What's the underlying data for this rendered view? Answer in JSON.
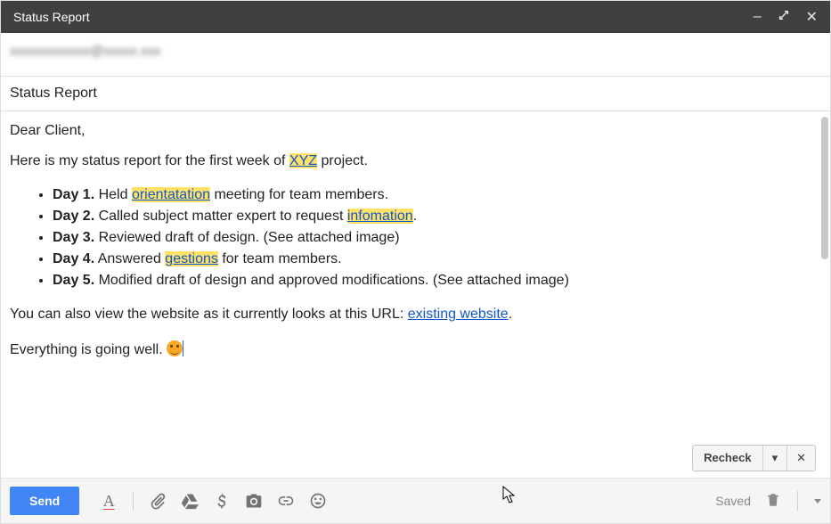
{
  "window": {
    "title": "Status Report",
    "controls": {
      "minimize": "–",
      "restore": "⤡",
      "close": "✕"
    }
  },
  "to_field": "xxxxxxxxxxxx@xxxxx.xxx",
  "subject": "Status Report",
  "body": {
    "greeting": "Dear Client,",
    "intro_pre": "Here is my status report for the first week of ",
    "intro_hl": "XYZ",
    "intro_post": " project.",
    "items": [
      {
        "day": "Day 1.",
        "pre": " Held ",
        "hl": "orientatation",
        "post": " meeting for team members."
      },
      {
        "day": "Day 2.",
        "pre": " Called subject matter expert to request ",
        "hl": "infomation",
        "post": "."
      },
      {
        "day": "Day 3.",
        "text": " Reviewed draft of design. (See attached image)"
      },
      {
        "day": "Day 4.",
        "pre": " Answered ",
        "hl": "gestions",
        "post": " for team members."
      },
      {
        "day": "Day 5.",
        "text": " Modified draft of design and approved modifications. (See attached image)"
      }
    ],
    "url_line_pre": "You can also view the website as it currently looks at this URL: ",
    "url_link": "existing website",
    "url_line_post": ".",
    "closing": "Everything is going well. "
  },
  "recheck": {
    "label": "Recheck",
    "caret": "▾",
    "close": "✕"
  },
  "toolbar": {
    "send": "Send",
    "saved": "Saved"
  }
}
